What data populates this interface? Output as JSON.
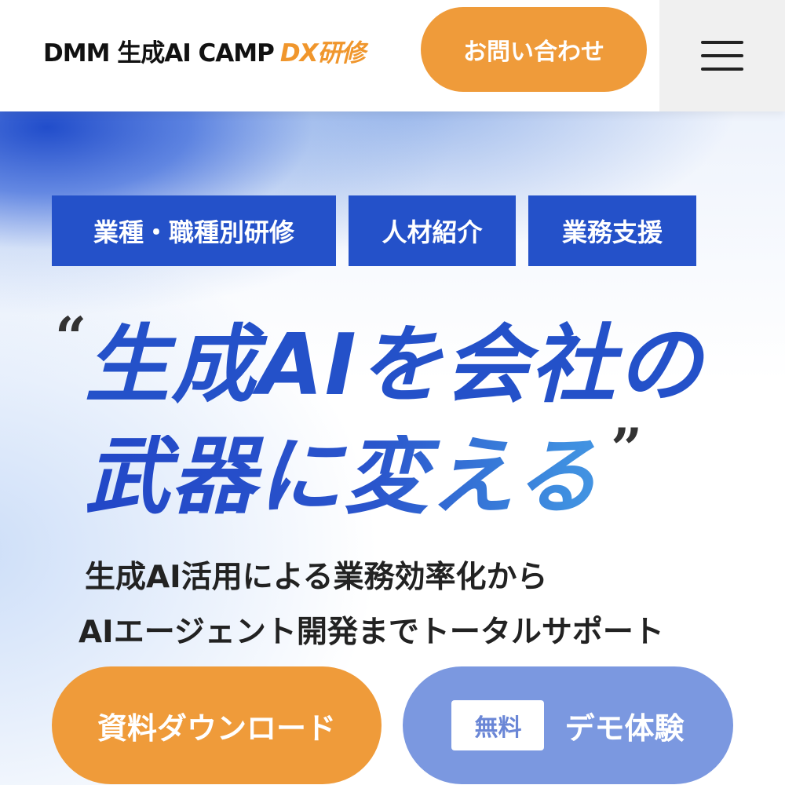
{
  "header": {
    "logo_main": "DMM 生成AI CAMP",
    "logo_sub": "DX研修",
    "contact_label": "お問い合わせ",
    "menu_icon": "hamburger-menu-icon"
  },
  "hero": {
    "tags": [
      {
        "label": "業種・職種別研修"
      },
      {
        "label": "人材紹介"
      },
      {
        "label": "業務支援"
      }
    ],
    "quote_open": "“",
    "quote_close": "”",
    "headline_line1": "生成AIを会社の",
    "headline_line2": "武器に変える",
    "subtext_line1": "生成AI活用による業務効率化から",
    "subtext_line2": "AIエージェント開発までトータルサポート",
    "cta_download": "資料ダウンロード",
    "cta_demo_badge": "無料",
    "cta_demo": "デモ体験"
  },
  "colors": {
    "accent_orange": "#ef9b3a",
    "primary_blue": "#2451c9",
    "demo_blue": "#7b98e0"
  }
}
